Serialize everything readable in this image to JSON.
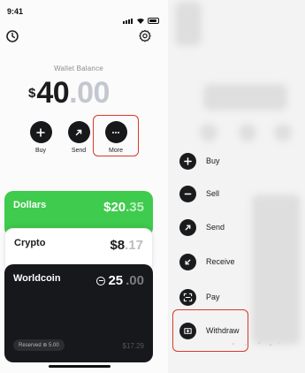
{
  "status_bar": {
    "time": "9:41"
  },
  "wallet": {
    "label": "Wallet Balance",
    "currency_symbol": "$",
    "integer": "40",
    "decimals": ".00"
  },
  "actions": [
    {
      "label": "Buy",
      "icon": "plus-icon"
    },
    {
      "label": "Send",
      "icon": "arrow-up-right-icon"
    },
    {
      "label": "More",
      "icon": "ellipsis-icon"
    }
  ],
  "cards": {
    "dollars": {
      "name": "Dollars",
      "amount_int": "$20",
      "amount_dec": ".35",
      "color": "#3fcb4d"
    },
    "crypto": {
      "name": "Crypto",
      "amount_int": "$8",
      "amount_dec": ".17"
    },
    "worldcoin": {
      "name": "Worldcoin",
      "amount_int": "25",
      "amount_dec": ".00",
      "reserved": "Reserved ⊛ 5.00",
      "fiat_value": "$17.29"
    }
  },
  "menu": {
    "items": [
      {
        "label": "Buy",
        "icon": "plus-icon"
      },
      {
        "label": "Sell",
        "icon": "minus-icon"
      },
      {
        "label": "Send",
        "icon": "arrow-up-right-icon"
      },
      {
        "label": "Receive",
        "icon": "arrow-down-left-icon"
      },
      {
        "label": "Pay",
        "icon": "scan-icon"
      },
      {
        "label": "Withdraw",
        "icon": "bank-icon"
      }
    ]
  },
  "colors": {
    "highlight": "#d63a2a",
    "accent_green": "#3fcb4d",
    "dark": "#17181b"
  }
}
